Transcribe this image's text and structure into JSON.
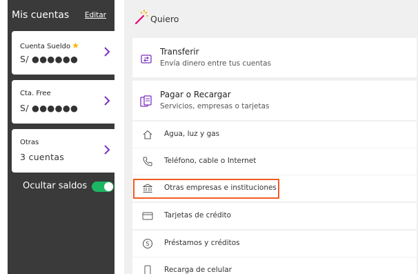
{
  "sidebar": {
    "title": "Mis cuentas",
    "edit_label": "Editar",
    "accounts": [
      {
        "name": "Cuenta Sueldo",
        "value": "S/ ●●●●●●",
        "favorite": true,
        "icon": "chevron-right-icon"
      },
      {
        "name": "Cta. Free",
        "value": "S/ ●●●●●●",
        "favorite": false,
        "icon": "chevron-right-icon"
      },
      {
        "name": "Otras",
        "value": "3 cuentas",
        "favorite": false,
        "icon": "chevron-right-icon"
      }
    ],
    "hide_balances": {
      "label": "Ocultar saldos",
      "on": true
    }
  },
  "main": {
    "header": "Quiero",
    "cards": [
      {
        "title": "Transferir",
        "subtitle": "Envía dinero entre tus cuentas",
        "icon": "transfer-icon"
      },
      {
        "title": "Pagar o Recargar",
        "subtitle": "Servicios, empresas o tarjetas",
        "icon": "documents-icon"
      }
    ],
    "items": [
      {
        "label": "Agua, luz y gas",
        "icon": "home-icon"
      },
      {
        "label": "Teléfono, cable o Internet",
        "icon": "phone-icon"
      },
      {
        "label": "Otras empresas e instituciones",
        "icon": "bank-icon",
        "highlighted": true
      },
      {
        "label": "Tarjetas de crédito",
        "icon": "credit-card-icon"
      },
      {
        "label": "Préstamos y créditos",
        "icon": "coin-icon"
      },
      {
        "label": "Recarga de celular",
        "icon": "mobile-icon"
      }
    ]
  },
  "colors": {
    "sidebar_bg": "#3a3a3a",
    "accent_purple": "#7b2fbf",
    "toggle_green": "#1db665",
    "highlight_orange": "#f05a22",
    "star_yellow": "#f5b400"
  }
}
